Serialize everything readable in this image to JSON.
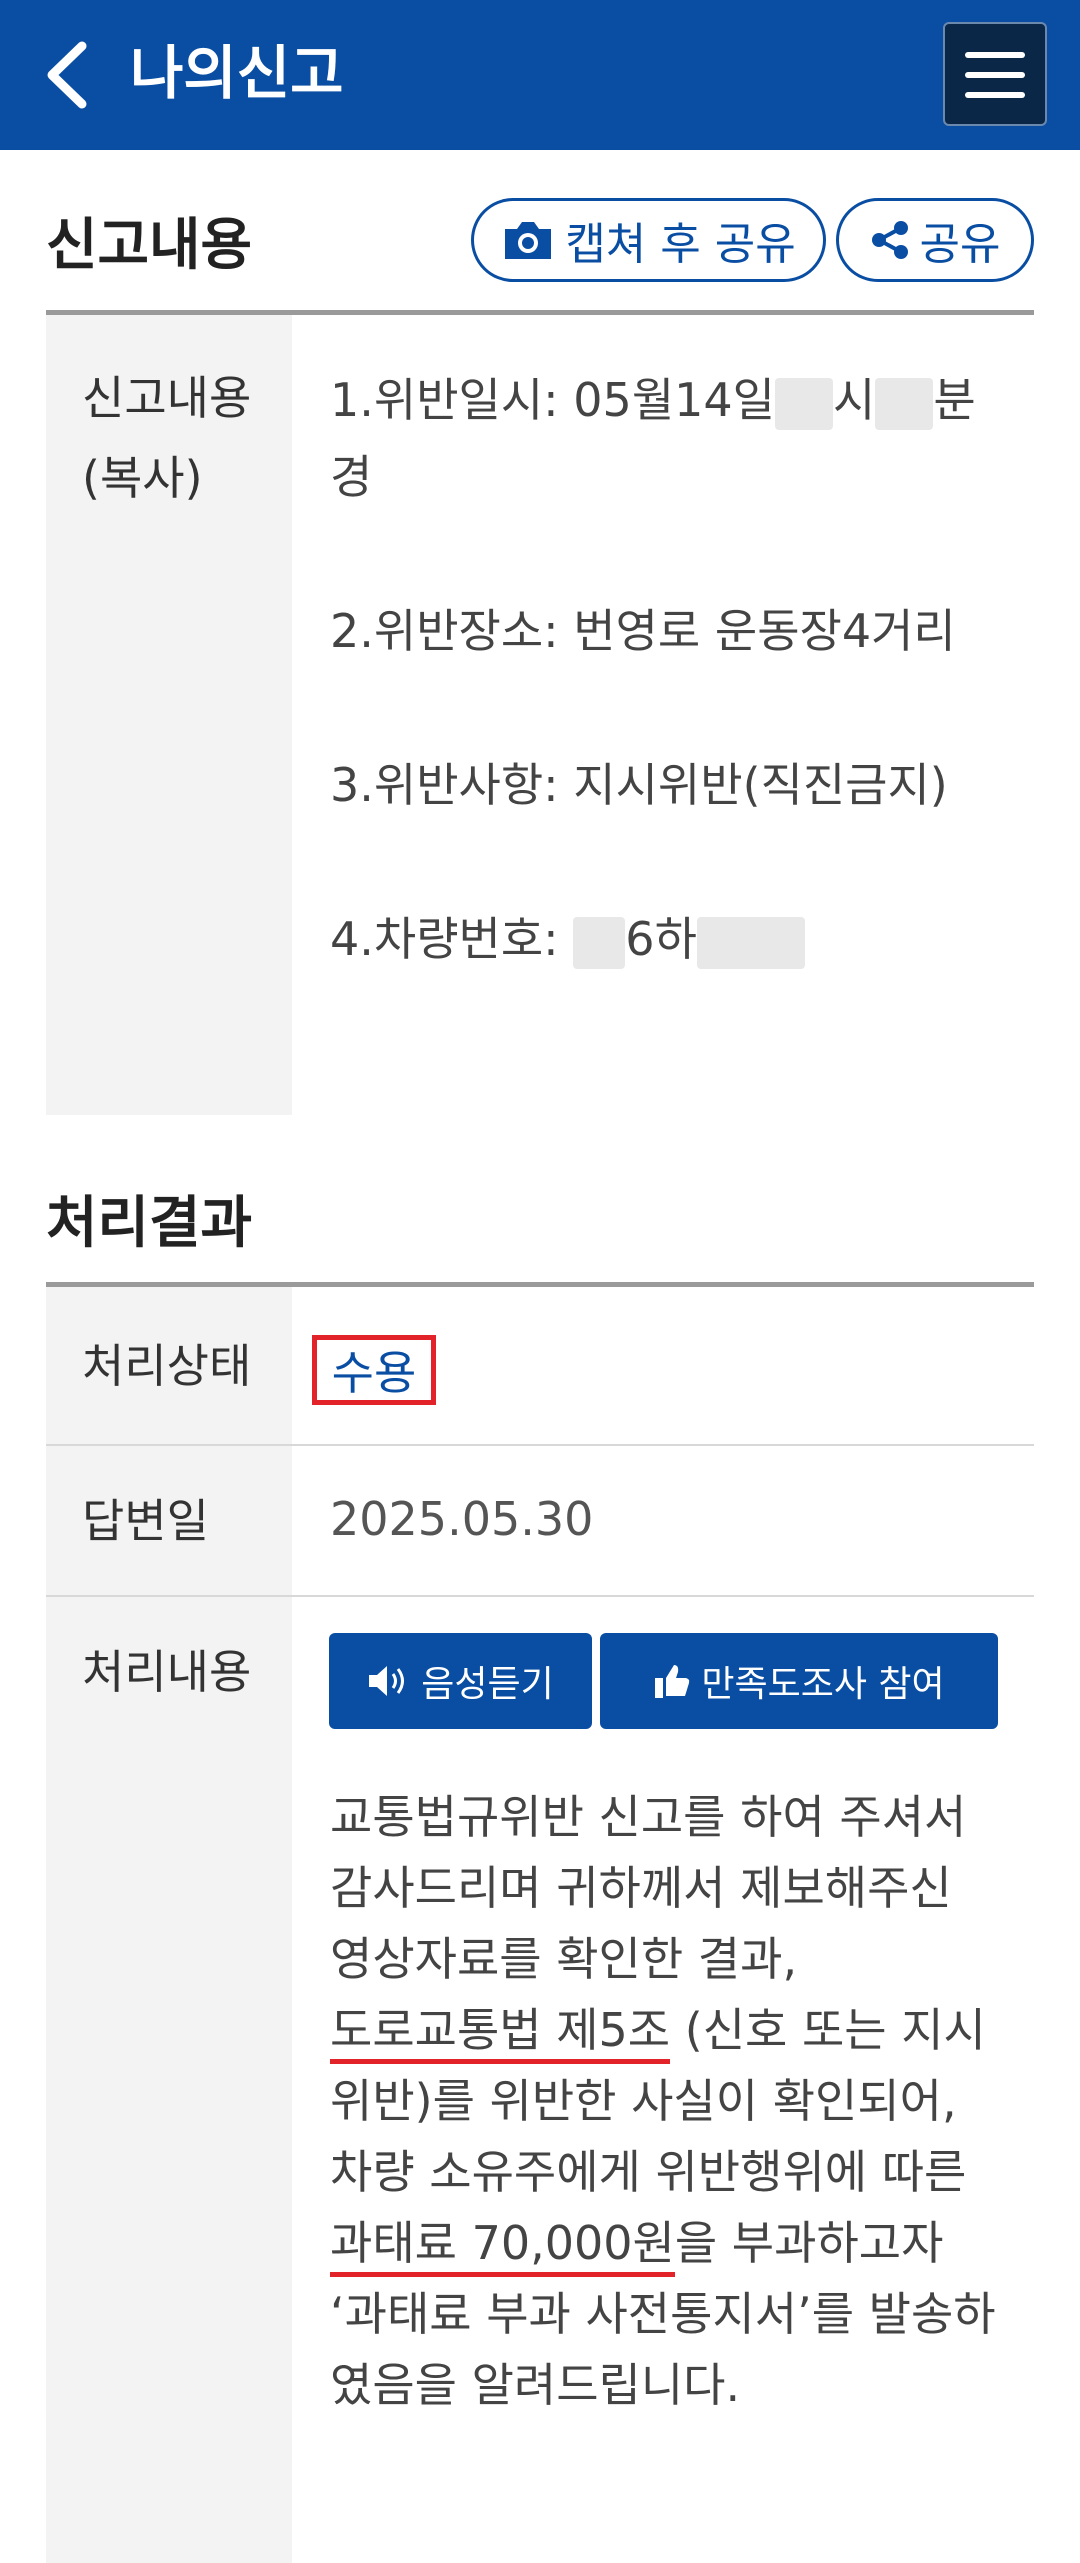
{
  "header": {
    "title": "나의신고",
    "back_icon": "chevron-left-icon",
    "menu_icon": "hamburger-menu-icon"
  },
  "report_section": {
    "title": "신고내용",
    "capture_share_label": "캡쳐 후 공유",
    "share_label": "공유",
    "label_line1": "신고내용",
    "label_line2": "(복사)",
    "items": {
      "date_prefix": "1.위반일시: 05월14일",
      "date_hour": "시",
      "date_min": "분",
      "date_suffix": "경",
      "location": "2.위반장소: 번영로 운동장4거리",
      "violation": "3.위반사항: 지시위반(직진금지)",
      "vehicle_prefix": "4.차량번호:",
      "vehicle_mid": "6하"
    }
  },
  "result_section": {
    "title": "처리결과",
    "status_label": "처리상태",
    "status_value": "수용",
    "reply_date_label": "답변일",
    "reply_date_value": "2025.05.30",
    "content_label": "처리내용",
    "listen_button": "음성듣기",
    "survey_button": "만족도조사 참여",
    "body": {
      "l1": "교통법규위반 신고를 하여 주셔서",
      "l2": "감사드리며 귀하께서 제보해주신",
      "l3": "영상자료를 확인한 결과,",
      "l4_ul": "도로교통법 제5조",
      "l4_rest": " (신호 또는 지시",
      "l5": "위반)를 위반한 사실이 확인되어,",
      "l6": "차량 소유주에게 위반행위에 따른",
      "l7_ul": "과태료 70,000원",
      "l7_rest": "을 부과하고자",
      "l8": "‘과태료 부과 사전통지서’를 발송하",
      "l9": "였음을 알려드립니다."
    }
  },
  "colors": {
    "primary": "#0a4ea3",
    "highlight": "#e2232a"
  }
}
